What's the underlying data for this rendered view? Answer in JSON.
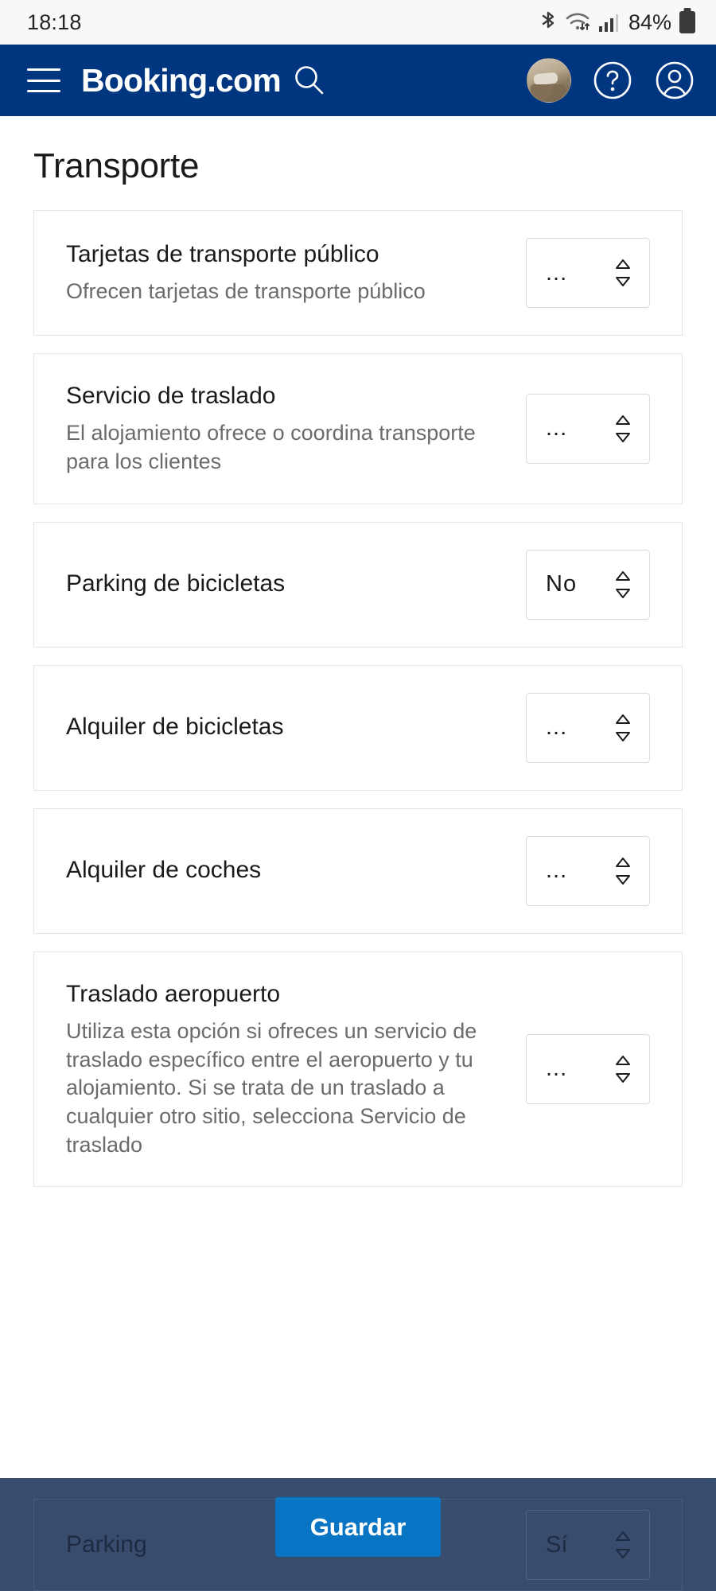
{
  "status_bar": {
    "time": "18:18",
    "battery_percent": "84%",
    "icons": [
      "bluetooth-icon",
      "wifi-icon",
      "cellular-signal-icon",
      "battery-icon"
    ]
  },
  "header": {
    "brand": "Booking.com",
    "brand_color": "#003580",
    "menu_icon": "hamburger-menu-icon",
    "search_icon": "search-icon",
    "avatar": "property-photo-avatar",
    "help_icon": "help-circle-icon",
    "account_icon": "user-account-icon"
  },
  "page": {
    "title": "Transporte"
  },
  "cards": [
    {
      "title": "Tarjetas de transporte público",
      "description": "Ofrecen tarjetas de transporte público",
      "value": "..."
    },
    {
      "title": "Servicio de traslado",
      "description": "El alojamiento ofrece o coordina transporte para los clientes",
      "value": "..."
    },
    {
      "title": "Parking de bicicletas",
      "description": "",
      "value": "No"
    },
    {
      "title": "Alquiler de bicicletas",
      "description": "",
      "value": "..."
    },
    {
      "title": "Alquiler de coches",
      "description": "",
      "value": "..."
    },
    {
      "title": "Traslado aeropuerto",
      "description": "Utiliza esta opción si ofreces un servicio de traslado específico entre el aeropuerto y tu alojamiento. Si se trata de un traslado a cualquier otro sitio, selecciona Servicio de traslado",
      "value": "..."
    }
  ],
  "partial_card": {
    "title": "Parking",
    "value": "Sí"
  },
  "bottom_bar": {
    "save_label": "Guardar",
    "save_color": "#0071c2",
    "overlay_color": "#32486a"
  }
}
